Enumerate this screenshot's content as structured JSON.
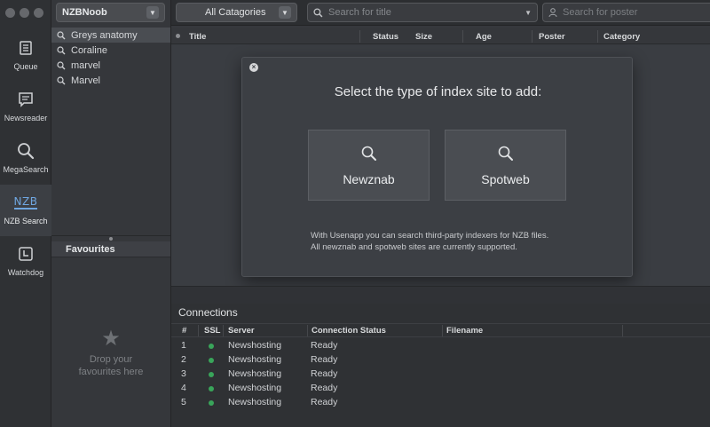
{
  "sidebar": {
    "items": [
      {
        "label": "Queue",
        "icon": "queue-icon"
      },
      {
        "label": "Newsreader",
        "icon": "newsreader-icon"
      },
      {
        "label": "MegaSearch",
        "icon": "search-icon"
      },
      {
        "label": "NZB Search",
        "icon": "nzb-icon",
        "glyph": "NZB"
      },
      {
        "label": "Watchdog",
        "icon": "watchdog-icon"
      }
    ]
  },
  "search_list": {
    "provider": "NZBNoob",
    "recent": [
      "Greys anatomy",
      "Coraline",
      "marvel",
      "Marvel"
    ],
    "favourites_title": "Favourites",
    "favourites_empty_line1": "Drop your",
    "favourites_empty_line2": "favourites here"
  },
  "toolbar": {
    "category": "All Catagories",
    "title_placeholder": "Search for title",
    "poster_placeholder": "Search for poster"
  },
  "results": {
    "columns": [
      "Title",
      "Status",
      "Size",
      "Age",
      "Poster",
      "Category"
    ]
  },
  "modal": {
    "title": "Select the type of index site to add:",
    "options": [
      "Newznab",
      "Spotweb"
    ],
    "footer_line1": "With Usenapp you can search third-party indexers for NZB files.",
    "footer_line2": "All newznab and spotweb sites are currently supported."
  },
  "connections": {
    "title": "Connections",
    "columns": [
      "#",
      "SSL",
      "Server",
      "Connection Status",
      "Filename"
    ],
    "rows": [
      {
        "num": "1",
        "server": "Newshosting",
        "status": "Ready"
      },
      {
        "num": "2",
        "server": "Newshosting",
        "status": "Ready"
      },
      {
        "num": "3",
        "server": "Newshosting",
        "status": "Ready"
      },
      {
        "num": "4",
        "server": "Newshosting",
        "status": "Ready"
      },
      {
        "num": "5",
        "server": "Newshosting",
        "status": "Ready"
      }
    ]
  },
  "colors": {
    "accent": "#6fa6e0",
    "ssl_ok": "#39a55a"
  }
}
